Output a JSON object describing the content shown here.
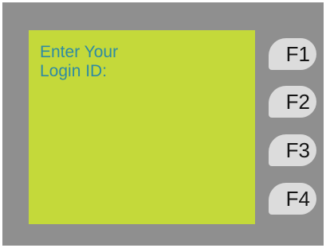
{
  "screen": {
    "prompt_line_1": "Enter Your",
    "prompt_line_2": "Login ID:"
  },
  "function_keys": [
    {
      "label": "F1"
    },
    {
      "label": "F2"
    },
    {
      "label": "F3"
    },
    {
      "label": "F4"
    }
  ],
  "colors": {
    "panel": "#8f8f8f",
    "lcd_background": "#c4d93a",
    "lcd_text": "#2e8aa3",
    "key_background": "#dcdcdc"
  }
}
